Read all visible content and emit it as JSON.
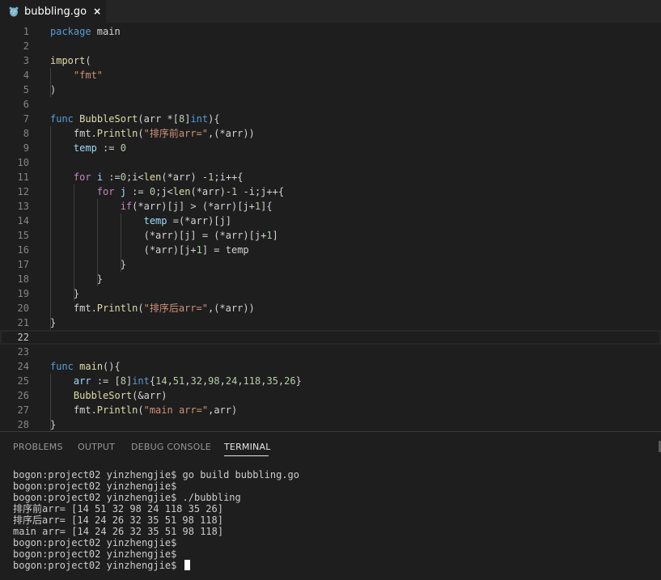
{
  "editor_tab": {
    "filename": "bubbling.go",
    "close_glyph": "×",
    "icon": "go-gopher-icon"
  },
  "code_lines": [
    {
      "n": "1",
      "tokens": [
        [
          "kw",
          "package"
        ],
        [
          "pl",
          " main"
        ]
      ]
    },
    {
      "n": "2",
      "tokens": []
    },
    {
      "n": "3",
      "tokens": [
        [
          "fn",
          "import"
        ],
        [
          "pl",
          "("
        ]
      ]
    },
    {
      "n": "4",
      "tokens": [
        [
          "pl",
          "    "
        ],
        [
          "str",
          "\"fmt\""
        ]
      ]
    },
    {
      "n": "5",
      "tokens": [
        [
          "pl",
          ")"
        ]
      ]
    },
    {
      "n": "6",
      "tokens": []
    },
    {
      "n": "7",
      "tokens": [
        [
          "kw",
          "func"
        ],
        [
          "pl",
          " "
        ],
        [
          "fn",
          "BubbleSort"
        ],
        [
          "pl",
          "(arr *["
        ],
        [
          "num",
          "8"
        ],
        [
          "pl",
          "]"
        ],
        [
          "kw",
          "int"
        ],
        [
          "pl",
          "){"
        ]
      ]
    },
    {
      "n": "8",
      "tokens": [
        [
          "pl",
          "    fmt."
        ],
        [
          "fn",
          "Println"
        ],
        [
          "pl",
          "("
        ],
        [
          "str",
          "\"排序前arr=\""
        ],
        [
          "pl",
          ",(*arr))"
        ]
      ]
    },
    {
      "n": "9",
      "tokens": [
        [
          "pl",
          "    "
        ],
        [
          "var",
          "temp"
        ],
        [
          "pl",
          " := "
        ],
        [
          "num",
          "0"
        ]
      ]
    },
    {
      "n": "10",
      "tokens": []
    },
    {
      "n": "11",
      "tokens": [
        [
          "pl",
          "    "
        ],
        [
          "ctl",
          "for"
        ],
        [
          "pl",
          " "
        ],
        [
          "var",
          "i"
        ],
        [
          "pl",
          " :="
        ],
        [
          "num",
          "0"
        ],
        [
          "pl",
          ";i<"
        ],
        [
          "fn",
          "len"
        ],
        [
          "pl",
          "(*arr) -"
        ],
        [
          "num",
          "1"
        ],
        [
          "pl",
          ";i++{"
        ]
      ]
    },
    {
      "n": "12",
      "tokens": [
        [
          "pl",
          "        "
        ],
        [
          "ctl",
          "for"
        ],
        [
          "pl",
          " "
        ],
        [
          "var",
          "j"
        ],
        [
          "pl",
          " := "
        ],
        [
          "num",
          "0"
        ],
        [
          "pl",
          ";j<"
        ],
        [
          "fn",
          "len"
        ],
        [
          "pl",
          "(*arr)-"
        ],
        [
          "num",
          "1"
        ],
        [
          "pl",
          " -i;j++{"
        ]
      ]
    },
    {
      "n": "13",
      "tokens": [
        [
          "pl",
          "            "
        ],
        [
          "ctl",
          "if"
        ],
        [
          "pl",
          "(*arr)[j] > (*arr)[j+"
        ],
        [
          "num",
          "1"
        ],
        [
          "pl",
          "]{"
        ]
      ]
    },
    {
      "n": "14",
      "tokens": [
        [
          "pl",
          "                "
        ],
        [
          "var",
          "temp"
        ],
        [
          "pl",
          " =(*arr)[j]"
        ]
      ]
    },
    {
      "n": "15",
      "tokens": [
        [
          "pl",
          "                (*arr)[j] = (*arr)[j+"
        ],
        [
          "num",
          "1"
        ],
        [
          "pl",
          "]"
        ]
      ]
    },
    {
      "n": "16",
      "tokens": [
        [
          "pl",
          "                (*arr)[j+"
        ],
        [
          "num",
          "1"
        ],
        [
          "pl",
          "] = temp"
        ]
      ]
    },
    {
      "n": "17",
      "tokens": [
        [
          "pl",
          "            }"
        ]
      ]
    },
    {
      "n": "18",
      "tokens": [
        [
          "pl",
          "        }"
        ]
      ]
    },
    {
      "n": "19",
      "tokens": [
        [
          "pl",
          "    }"
        ]
      ]
    },
    {
      "n": "20",
      "tokens": [
        [
          "pl",
          "    fmt."
        ],
        [
          "fn",
          "Println"
        ],
        [
          "pl",
          "("
        ],
        [
          "str",
          "\"排序后arr=\""
        ],
        [
          "pl",
          ",(*arr))"
        ]
      ]
    },
    {
      "n": "21",
      "tokens": [
        [
          "pl",
          "}"
        ]
      ]
    },
    {
      "n": "22",
      "tokens": []
    },
    {
      "n": "23",
      "tokens": []
    },
    {
      "n": "24",
      "tokens": [
        [
          "kw",
          "func"
        ],
        [
          "pl",
          " "
        ],
        [
          "fn",
          "main"
        ],
        [
          "pl",
          "(){"
        ]
      ]
    },
    {
      "n": "25",
      "tokens": [
        [
          "pl",
          "    "
        ],
        [
          "var",
          "arr"
        ],
        [
          "pl",
          " := ["
        ],
        [
          "num",
          "8"
        ],
        [
          "pl",
          "]"
        ],
        [
          "kw",
          "int"
        ],
        [
          "pl",
          "{"
        ],
        [
          "num",
          "14"
        ],
        [
          "pl",
          ","
        ],
        [
          "num",
          "51"
        ],
        [
          "pl",
          ","
        ],
        [
          "num",
          "32"
        ],
        [
          "pl",
          ","
        ],
        [
          "num",
          "98"
        ],
        [
          "pl",
          ","
        ],
        [
          "num",
          "24"
        ],
        [
          "pl",
          ","
        ],
        [
          "num",
          "118"
        ],
        [
          "pl",
          ","
        ],
        [
          "num",
          "35"
        ],
        [
          "pl",
          ","
        ],
        [
          "num",
          "26"
        ],
        [
          "pl",
          "}"
        ]
      ]
    },
    {
      "n": "26",
      "tokens": [
        [
          "pl",
          "    "
        ],
        [
          "fn",
          "BubbleSort"
        ],
        [
          "pl",
          "(&arr)"
        ]
      ]
    },
    {
      "n": "27",
      "tokens": [
        [
          "pl",
          "    fmt."
        ],
        [
          "fn",
          "Println"
        ],
        [
          "pl",
          "("
        ],
        [
          "str",
          "\"main arr=\""
        ],
        [
          "pl",
          ",arr)"
        ]
      ]
    },
    {
      "n": "28",
      "tokens": [
        [
          "pl",
          "}"
        ]
      ]
    }
  ],
  "current_line": "22",
  "panel": {
    "tabs": [
      "PROBLEMS",
      "OUTPUT",
      "DEBUG CONSOLE",
      "TERMINAL"
    ],
    "active_tab": "TERMINAL"
  },
  "terminal_lines": [
    "bogon:project02 yinzhengjie$ go build bubbling.go",
    "bogon:project02 yinzhengjie$",
    "bogon:project02 yinzhengjie$ ./bubbling",
    "排序前arr= [14 51 32 98 24 118 35 26]",
    "排序后arr= [14 24 26 32 35 51 98 118]",
    "main arr= [14 24 26 32 35 51 98 118]",
    "bogon:project02 yinzhengjie$",
    "bogon:project02 yinzhengjie$",
    "bogon:project02 yinzhengjie$ "
  ],
  "colors": {
    "keyword": "#569cd6",
    "control": "#c586c0",
    "function": "#dcdcaa",
    "string": "#ce9178",
    "number": "#b5cea8",
    "variable": "#9cdcfe",
    "plain": "#d4d4d4",
    "background": "#1e1e1e"
  }
}
